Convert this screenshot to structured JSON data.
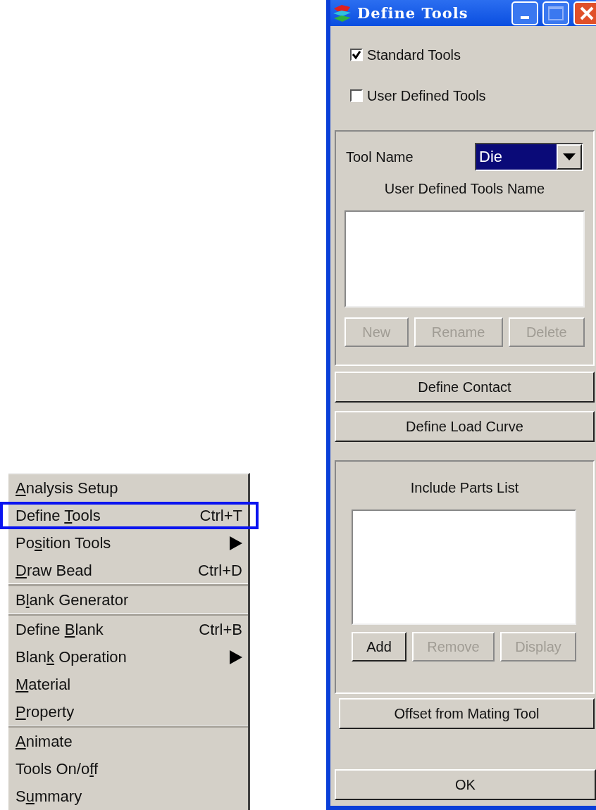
{
  "menu": {
    "groups": [
      [
        {
          "key": "A",
          "after": "nalysis Setup",
          "submenu": false,
          "annotated": false
        },
        {
          "before": "Define ",
          "key": "T",
          "after": "ools",
          "shortcut": "Ctrl+T",
          "submenu": false,
          "annotated": true
        },
        {
          "before": "Po",
          "key": "s",
          "after": "ition Tools",
          "submenu": true,
          "annotated": false
        },
        {
          "key": "D",
          "after": "raw Bead",
          "shortcut": "Ctrl+D",
          "submenu": false,
          "annotated": false
        }
      ],
      [
        {
          "before": "B",
          "key": "l",
          "after": "ank Generator",
          "submenu": false,
          "annotated": false
        }
      ],
      [
        {
          "before": "Define ",
          "key": "B",
          "after": "lank",
          "shortcut": "Ctrl+B",
          "submenu": false,
          "annotated": false
        },
        {
          "before": "Blan",
          "key": "k",
          "after": " Operation",
          "submenu": true,
          "annotated": false
        },
        {
          "key": "M",
          "after": "aterial",
          "submenu": false,
          "annotated": false
        },
        {
          "key": "P",
          "after": "roperty",
          "submenu": false,
          "annotated": false
        }
      ],
      [
        {
          "key": "A",
          "after": "nimate",
          "submenu": false,
          "annotated": false
        },
        {
          "before": "Tools On/o",
          "key": "f",
          "after": "f",
          "submenu": false,
          "annotated": false
        },
        {
          "before": "S",
          "key": "u",
          "after": "mmary",
          "submenu": false,
          "annotated": false
        }
      ]
    ]
  },
  "dialog": {
    "title": "Define Tools",
    "checkboxes": [
      {
        "label": "Standard Tools",
        "checked": true
      },
      {
        "label": "User Defined Tools",
        "checked": false
      }
    ],
    "tool_panel": {
      "tool_name_label": "Tool Name",
      "tool_name_value": "Die",
      "list_label": "User Defined Tools Name",
      "buttons": [
        {
          "label": "New",
          "disabled": true
        },
        {
          "label": "Rename",
          "disabled": true
        },
        {
          "label": "Delete",
          "disabled": true
        }
      ]
    },
    "buttons_1": [
      "Define Contact",
      "Define Load Curve"
    ],
    "parts_panel": {
      "label": "Include Parts List",
      "buttons": [
        {
          "label": "Add",
          "disabled": false
        },
        {
          "label": "Remove",
          "disabled": true
        },
        {
          "label": "Display",
          "disabled": true
        }
      ]
    },
    "offset_button": "Offset from Mating Tool",
    "ok_button": "OK"
  }
}
